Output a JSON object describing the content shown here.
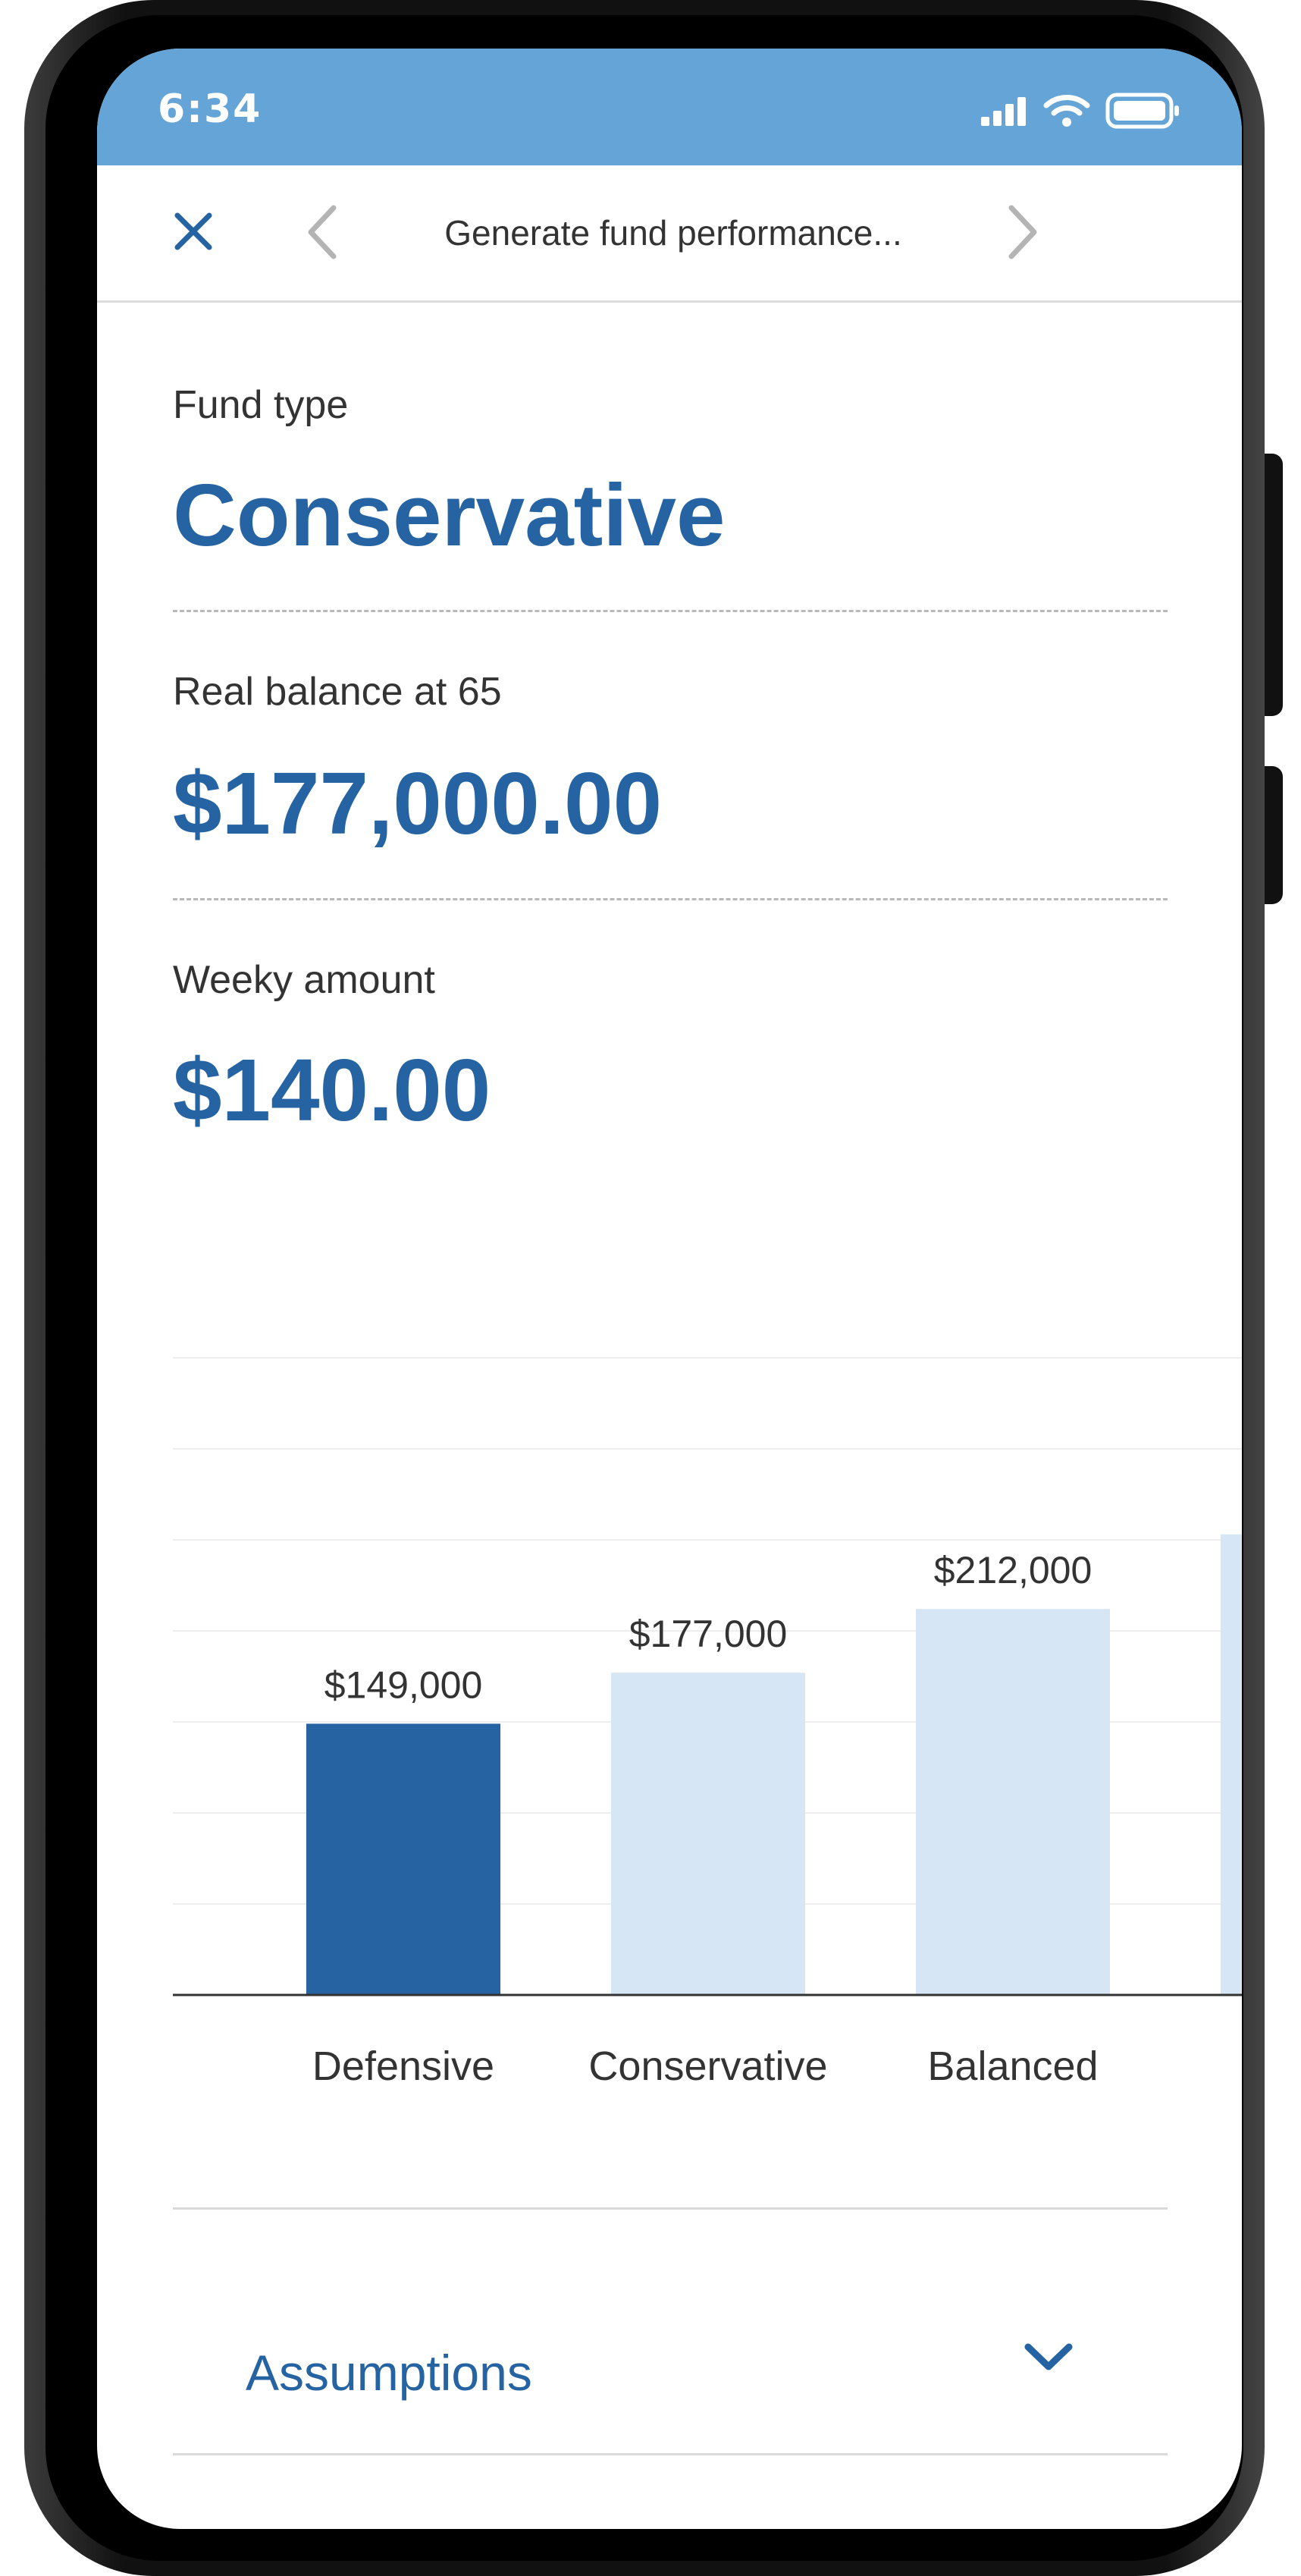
{
  "status_bar": {
    "time": "6:34",
    "icons": [
      "cellular-signal-icon",
      "wifi-icon",
      "battery-icon"
    ],
    "background": "#65a4d6"
  },
  "nav": {
    "title": "Generate fund performance...",
    "close_icon": "close-icon",
    "prev_icon": "chevron-left-icon",
    "next_icon": "chevron-right-icon"
  },
  "summary": {
    "fund_type_label": "Fund type",
    "fund_type_value": "Conservative",
    "balance_label": "Real balance at 65",
    "balance_value": "$177,000.00",
    "weekly_label": "Weeky amount",
    "weekly_value": "$140.00"
  },
  "chart_data": {
    "type": "bar",
    "categories": [
      "Defensive",
      "Conservative",
      "Balanced",
      ""
    ],
    "values": [
      149000,
      177000,
      212000,
      253000
    ],
    "value_labels": [
      "$149,000",
      "$177,000",
      "$212,000",
      "$"
    ],
    "highlighted_index": 0,
    "colors": {
      "highlight": "#2563a2",
      "default": "#d6e6f5"
    },
    "grid": true,
    "ylim": [
      0,
      350000
    ]
  },
  "accordion": {
    "title": "Assumptions",
    "icon": "chevron-down-icon"
  },
  "colors": {
    "accent": "#2563a2",
    "text": "#333333"
  }
}
